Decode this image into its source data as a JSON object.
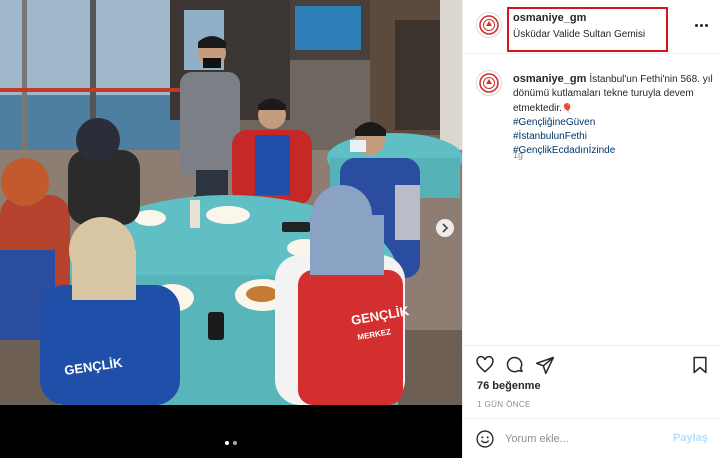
{
  "post": {
    "username": "osmaniye_gm",
    "location": "Üsküdar Valide Sultan Gemisi",
    "caption_text": "İstanbul'un Fethi'nin 568. yıl dönümü kutlamaları tekne turuyla devem etmektedir.",
    "caption_emoji": "🎈",
    "hashtags": [
      "#GençliğineGüven",
      "#İstanbulunFethi",
      "#GençlikEcdadınİzinde"
    ],
    "caption_time": "1g",
    "likes": "76 beğenme",
    "time_ago": "1 GÜN ÖNCE"
  },
  "comment": {
    "placeholder": "Yorum ekle...",
    "post_label": "Paylaş"
  },
  "photo": {
    "vest_print": "GENÇLİK MERKEZLERİ",
    "vest_print_2": "GENÇLİK MERKEZİ"
  },
  "colors": {
    "highlight_box": "#d9121f",
    "hashtag": "#00376b",
    "post_button_disabled": "#b2dffc",
    "table_cloth": "#5fbfc4"
  },
  "icons": [
    "next-arrow-icon",
    "more-options-icon",
    "heart-icon",
    "comment-icon",
    "share-icon",
    "bookmark-icon",
    "emoji-icon",
    "gsb-logo-icon"
  ]
}
